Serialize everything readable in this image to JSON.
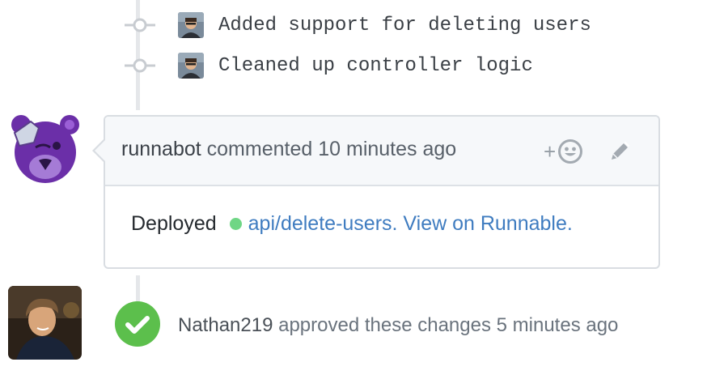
{
  "commits": [
    {
      "message": "Added support for deleting users",
      "avatar_icon": "user-avatar-icon"
    },
    {
      "message": "Cleaned up controller logic",
      "avatar_icon": "user-avatar-icon"
    }
  ],
  "comment": {
    "author": "runnabot",
    "action": "commented",
    "time": "10 minutes ago",
    "reaction_plus": "+",
    "body_prefix": "Deployed",
    "link_text": "api/delete-users. View on Runnable.",
    "status_color": "#6fd685",
    "link_color": "#3f7cc0"
  },
  "review": {
    "user": "Nathan219",
    "text": "approved these changes 5 minutes ago",
    "badge_color": "#5cbf4c"
  }
}
